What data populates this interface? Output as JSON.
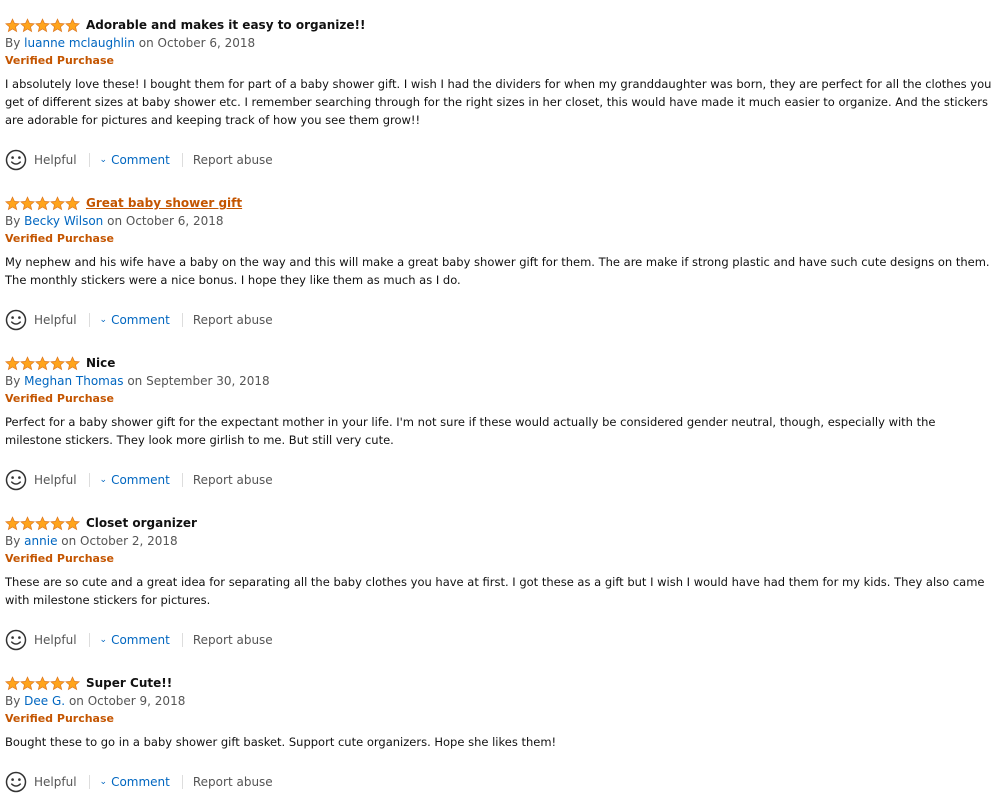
{
  "colors": {
    "star_fill": "#FFA41C",
    "star_stroke": "#DE7921",
    "link": "#0066c0",
    "verified": "#c45500",
    "title_link": "#c45500"
  },
  "icons": {
    "rating": "star-icon",
    "helpful": "smiley-face-icon",
    "comment_toggle": "chevron-down-icon"
  },
  "actions": {
    "helpful_label": "Helpful",
    "comment_label": "Comment",
    "report_label": "Report abuse"
  },
  "reviews": [
    {
      "rating": 5,
      "title": "Adorable and makes it easy to organize!!",
      "by": "By",
      "author": "luanne mclaughlin",
      "date": "on October 6, 2018",
      "verified": "Verified Purchase",
      "body": "I absolutely love these! I bought them for part of a baby shower gift. I wish I had the dividers for when my granddaughter was born, they are perfect for all the clothes you get of different sizes at baby shower etc. I remember searching through for the right sizes in her closet, this would have made it much easier to organize. And the stickers are adorable for pictures and keeping track of how you see them grow!!"
    },
    {
      "rating": 5,
      "title": "Great baby shower gift",
      "by": "By",
      "author": "Becky Wilson",
      "date": "on October 6, 2018",
      "verified": "Verified Purchase",
      "body": "My nephew and his wife have a baby on the way and this will make a great baby shower gift for them. The are make if strong plastic and have such cute designs on them. The monthly stickers were a nice bonus. I hope they like them as much as I do."
    },
    {
      "rating": 5,
      "title": "Nice",
      "by": "By",
      "author": "Meghan Thomas",
      "date": "on September 30, 2018",
      "verified": "Verified Purchase",
      "body": "Perfect for a baby shower gift for the expectant mother in your life. I'm not sure if these would actually be considered gender neutral, though, especially with the milestone stickers. They look more girlish to me. But still very cute."
    },
    {
      "rating": 5,
      "title": "Closet organizer",
      "by": "By",
      "author": "annie",
      "date": "on October 2, 2018",
      "verified": "Verified Purchase",
      "body": "These are so cute and a great idea for separating all the baby clothes you have at first. I got these as a gift but I wish I would have had them for my kids. They also came with milestone stickers for pictures."
    },
    {
      "rating": 5,
      "title": "Super Cute!!",
      "by": "By",
      "author": "Dee G.",
      "date": "on October 9, 2018",
      "verified": "Verified Purchase",
      "body": "Bought these to go in a baby shower gift basket. Support cute organizers. Hope she likes them!"
    }
  ]
}
